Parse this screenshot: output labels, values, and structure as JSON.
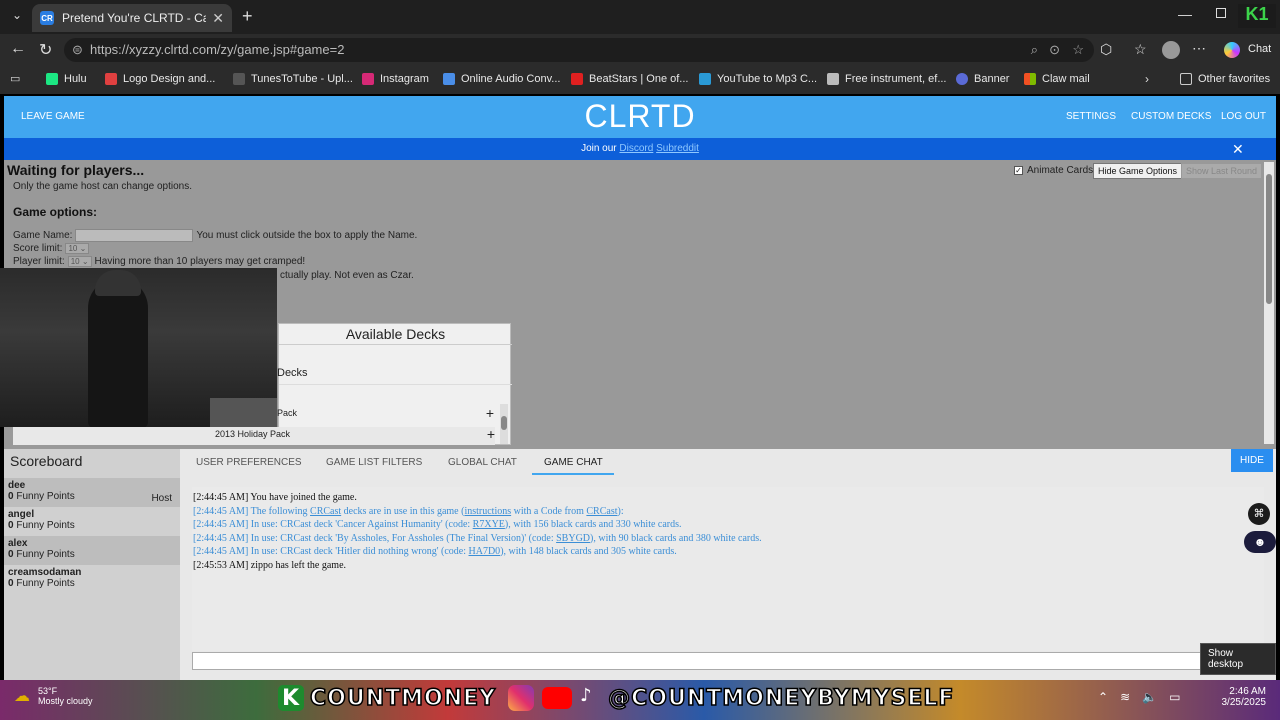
{
  "browser": {
    "tab_title": "Pretend You're CLRTD - Cards Aga",
    "tab_favicon": "CR",
    "url": "https://xyzzy.clrtd.com/zy/game.jsp#game=2",
    "chat_label": "Chat",
    "bookmarks": [
      {
        "label": "Hulu",
        "color": "#1ce783"
      },
      {
        "label": "Logo Design and...",
        "color": "#e04040"
      },
      {
        "label": "TunesToTube - Upl...",
        "color": "#555555"
      },
      {
        "label": "Instagram",
        "color": "#d62976"
      },
      {
        "label": "Online Audio Conv...",
        "color": "#4a8ee8"
      },
      {
        "label": "BeatStars | One of...",
        "color": "#e02020"
      },
      {
        "label": "YouTube to Mp3 C...",
        "color": "#2a9ad6"
      },
      {
        "label": "Free instrument, ef...",
        "color": "#bbbbbb"
      },
      {
        "label": "Banner",
        "color": "#5a6ad6"
      },
      {
        "label": "Claw mail",
        "color": "#f25022"
      }
    ],
    "other_favorites": "Other favorites"
  },
  "site": {
    "logo": "CLRTD",
    "leave_game": "LEAVE GAME",
    "settings": "SETTINGS",
    "custom_decks": "CUSTOM DECKS",
    "log_out": "LOG OUT",
    "banner_prefix": "Join our",
    "banner_discord": "Discord",
    "banner_subreddit": "Subreddit"
  },
  "game": {
    "status": "Waiting for players...",
    "host_note": "Only the game host can change options.",
    "animate_cards": "Animate Cards",
    "hide_options": "Hide Game Options",
    "show_last_round": "Show Last Round",
    "options_heading": "Game options:",
    "name_label": "Game Name:",
    "name_note": "You must click outside the box to apply the Name.",
    "score_label": "Score limit:",
    "score_value": "10",
    "player_label": "Player limit:",
    "player_value": "10",
    "player_note": "Having more than 10 players may get cramped!",
    "spectator_note": "ctually play. Not even as Czar.",
    "decks_title": "Available Decks",
    "decks_sub": "Decks",
    "deck_items": [
      "Pack",
      "2013 Holiday Pack"
    ]
  },
  "scoreboard": {
    "title": "Scoreboard",
    "players": [
      {
        "name": "dee",
        "score": "0",
        "unit": "Funny Points",
        "role": "Host"
      },
      {
        "name": "angel",
        "score": "0",
        "unit": "Funny Points",
        "role": ""
      },
      {
        "name": "alex",
        "score": "0",
        "unit": "Funny Points",
        "role": ""
      },
      {
        "name": "creamsodaman",
        "score": "0",
        "unit": "Funny Points",
        "role": ""
      }
    ]
  },
  "chat": {
    "tabs": [
      "USER PREFERENCES",
      "GAME LIST FILTERS",
      "GLOBAL CHAT",
      "GAME CHAT"
    ],
    "hide": "HIDE",
    "lines": {
      "l1": "[2:44:45 AM] You have joined the game.",
      "l2a": "[2:44:45 AM] The following ",
      "l2b": "CRCast",
      "l2c": " decks are in use in this game (",
      "l2d": "instructions",
      "l2e": " with a Code from ",
      "l2f": "CRCast",
      "l2g": "):",
      "l3a": "[2:44:45 AM] In use: CRCast deck 'Cancer Against Humanity' (code: ",
      "l3b": "R7XYE",
      "l3c": "), with 156 black cards and 330 white cards.",
      "l4a": "[2:44:45 AM] In use: CRCast deck 'By Assholes, For Assholes (The Final Version)' (code: ",
      "l4b": "SBYGD",
      "l4c": "), with 90 black cards and 380 white cards.",
      "l5a": "[2:44:45 AM] In use: CRCast deck 'Hitler did nothing wrong' (code: ",
      "l5b": "HA7D0",
      "l5c": "), with 148 black cards and 305 white cards.",
      "l6": "[2:45:53 AM] zippo has left the game."
    }
  },
  "desktop": {
    "weather_temp": "53°F",
    "weather_desc": "Mostly cloudy",
    "brand_name": "COUNTMONEY",
    "brand_handle": "@COUNTMONEYBYMYSELF",
    "time": "2:46 AM",
    "date": "3/25/2025",
    "show_desktop": "Show desktop"
  }
}
